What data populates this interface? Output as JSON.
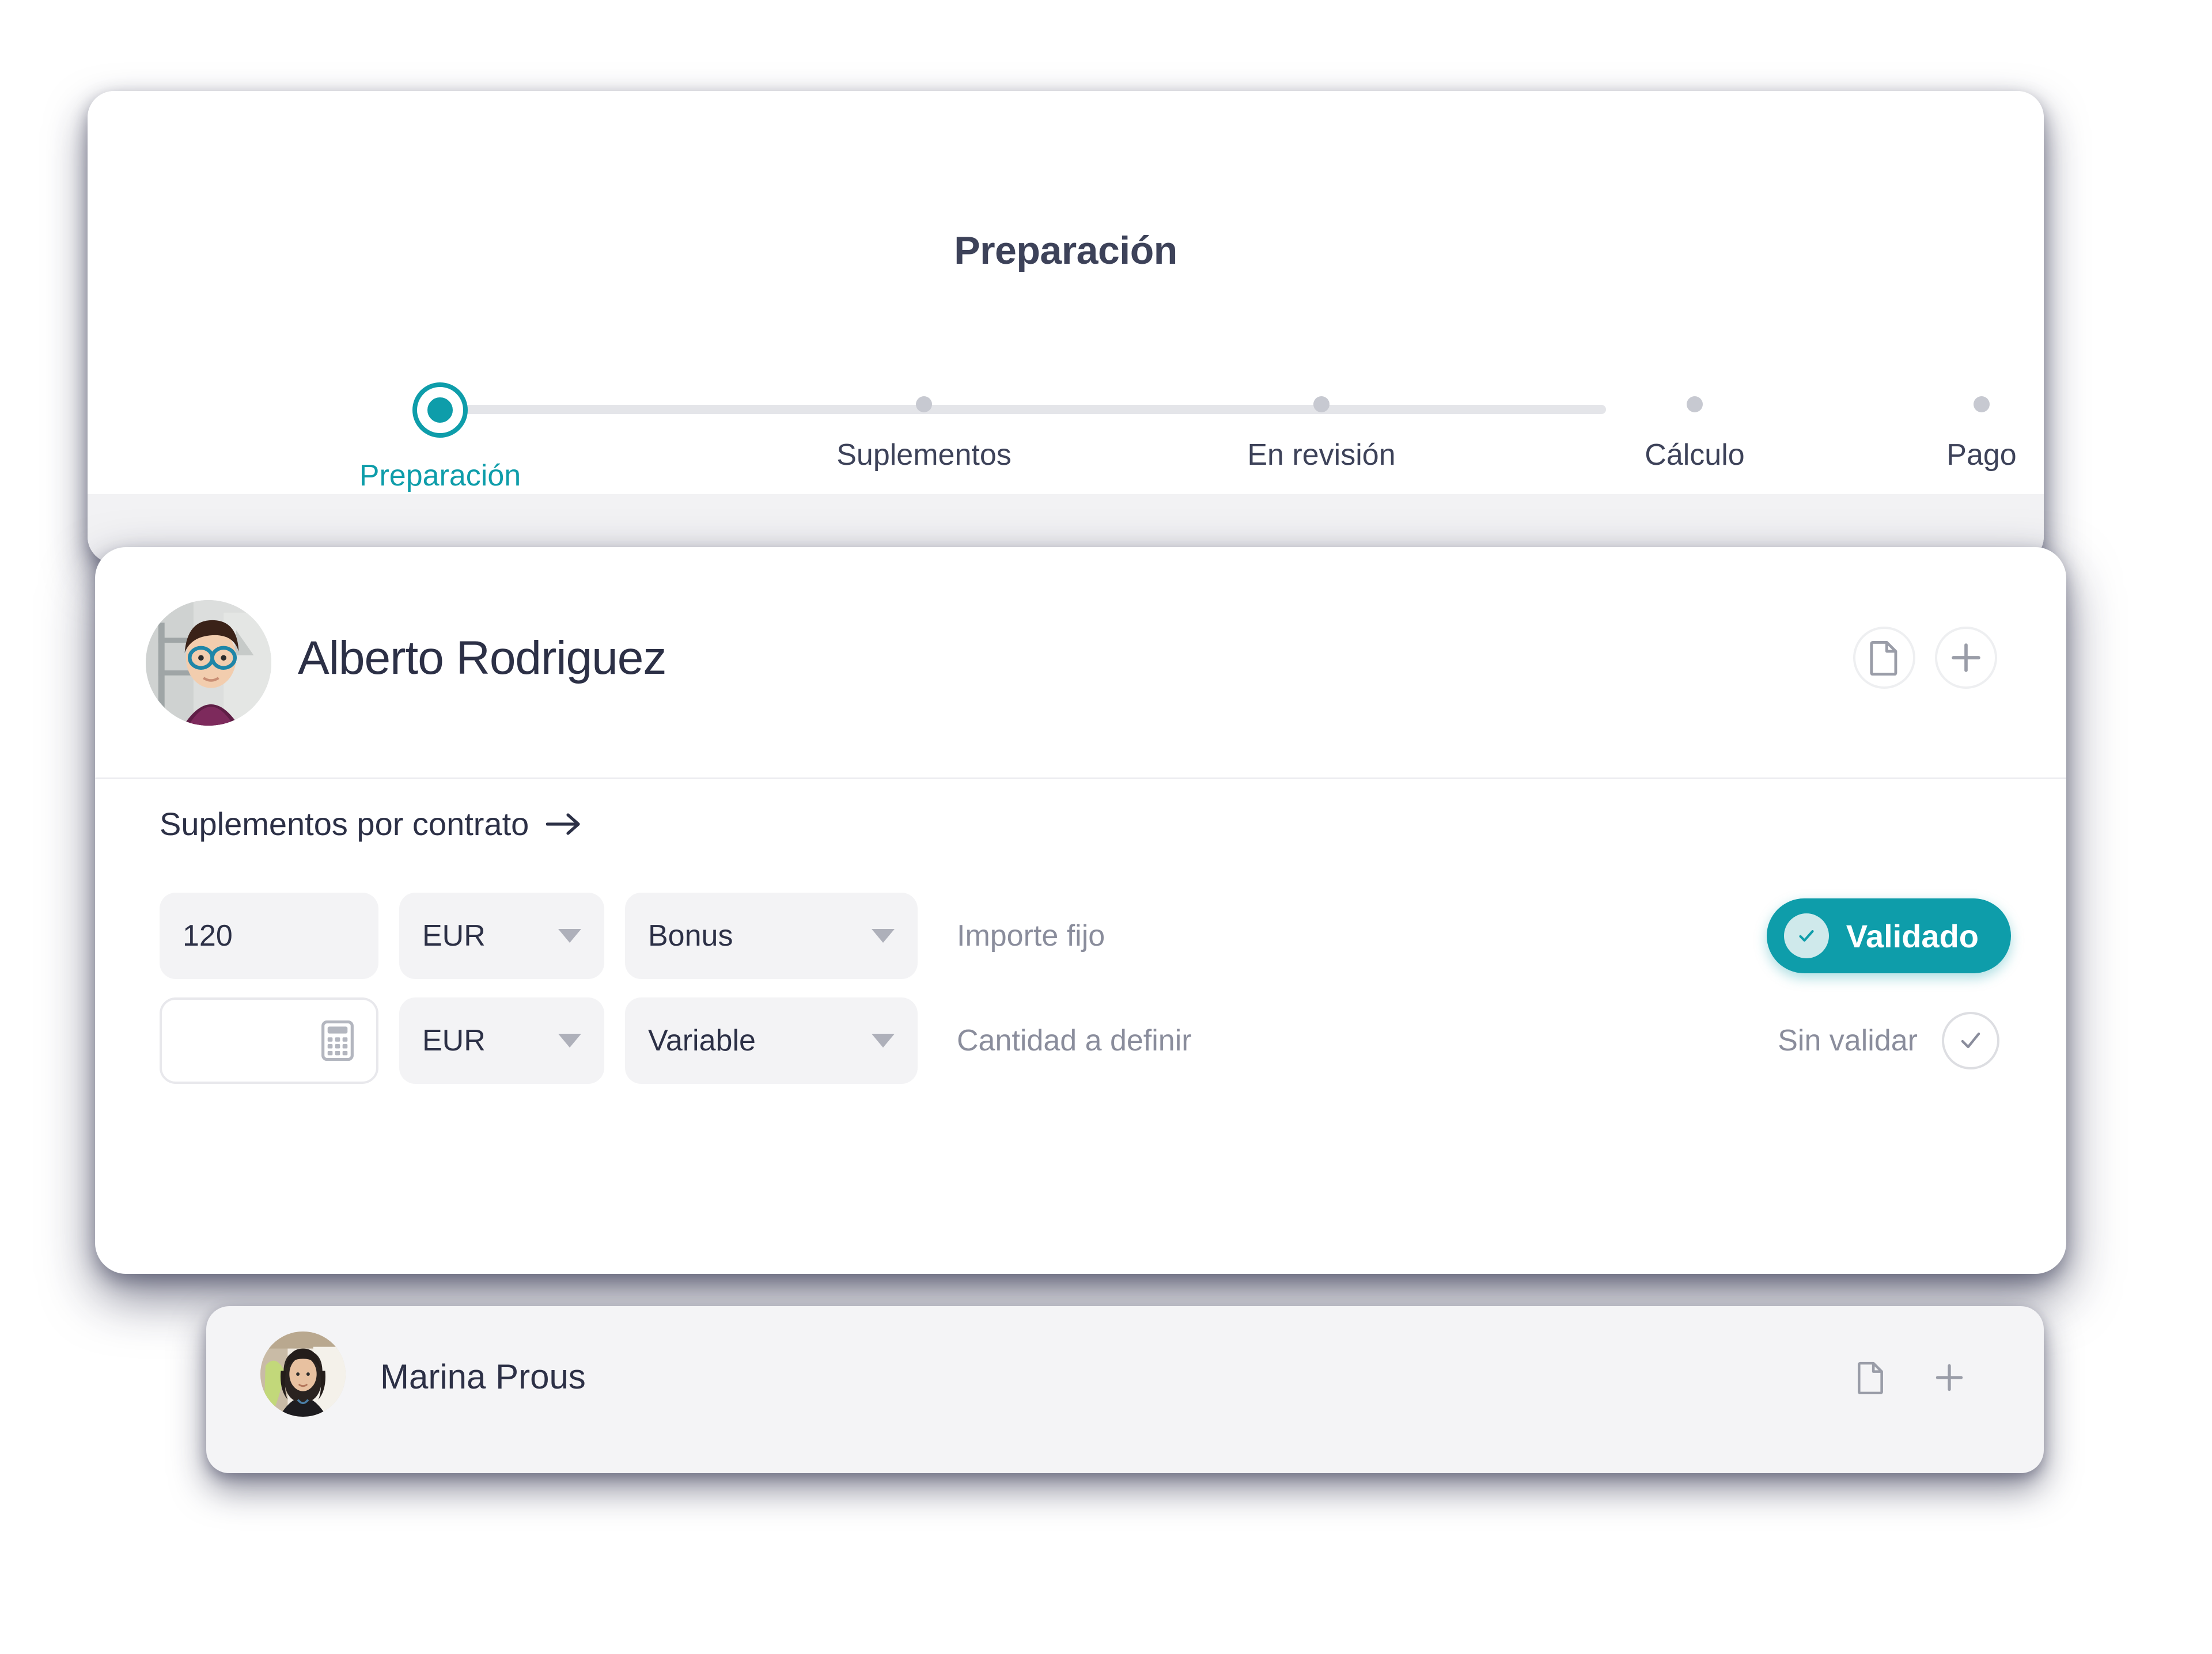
{
  "header": {
    "title": "Preparación"
  },
  "stepper": {
    "steps": [
      {
        "label": "Preparación",
        "state": "active"
      },
      {
        "label": "Suplementos",
        "state": "upcoming"
      },
      {
        "label": "En revisión",
        "state": "upcoming"
      },
      {
        "label": "Cálculo",
        "state": "upcoming"
      },
      {
        "label": "Pago",
        "state": "upcoming"
      }
    ]
  },
  "employee_card": {
    "name": "Alberto Rodriguez",
    "avatar_alt": "alberto-rodriguez-photo",
    "actions": {
      "document_label": "document-icon",
      "add_label": "plus-icon"
    },
    "section": {
      "title": "Suplementos por contrato",
      "arrow": "→"
    },
    "rows": [
      {
        "amount": "120",
        "amount_placeholder": "",
        "currency": "EUR",
        "type": "Bonus",
        "note": "Importe fijo",
        "status_label": "Validado",
        "status": "validated"
      },
      {
        "amount": "",
        "amount_placeholder": "",
        "currency": "EUR",
        "type": "Variable",
        "note": "Cantidad a definir",
        "status_label": "Sin validar",
        "status": "unvalidated"
      }
    ]
  },
  "next_card": {
    "name": "Marina Prous",
    "avatar_alt": "marina-prous-photo",
    "actions": {
      "document_label": "document-icon",
      "add_label": "plus-icon"
    }
  },
  "colors": {
    "accent": "#0e9daa",
    "text": "#2c3046",
    "muted": "#8a8d9c",
    "field_bg": "#f3f3f5",
    "track": "#e4e5e9"
  }
}
